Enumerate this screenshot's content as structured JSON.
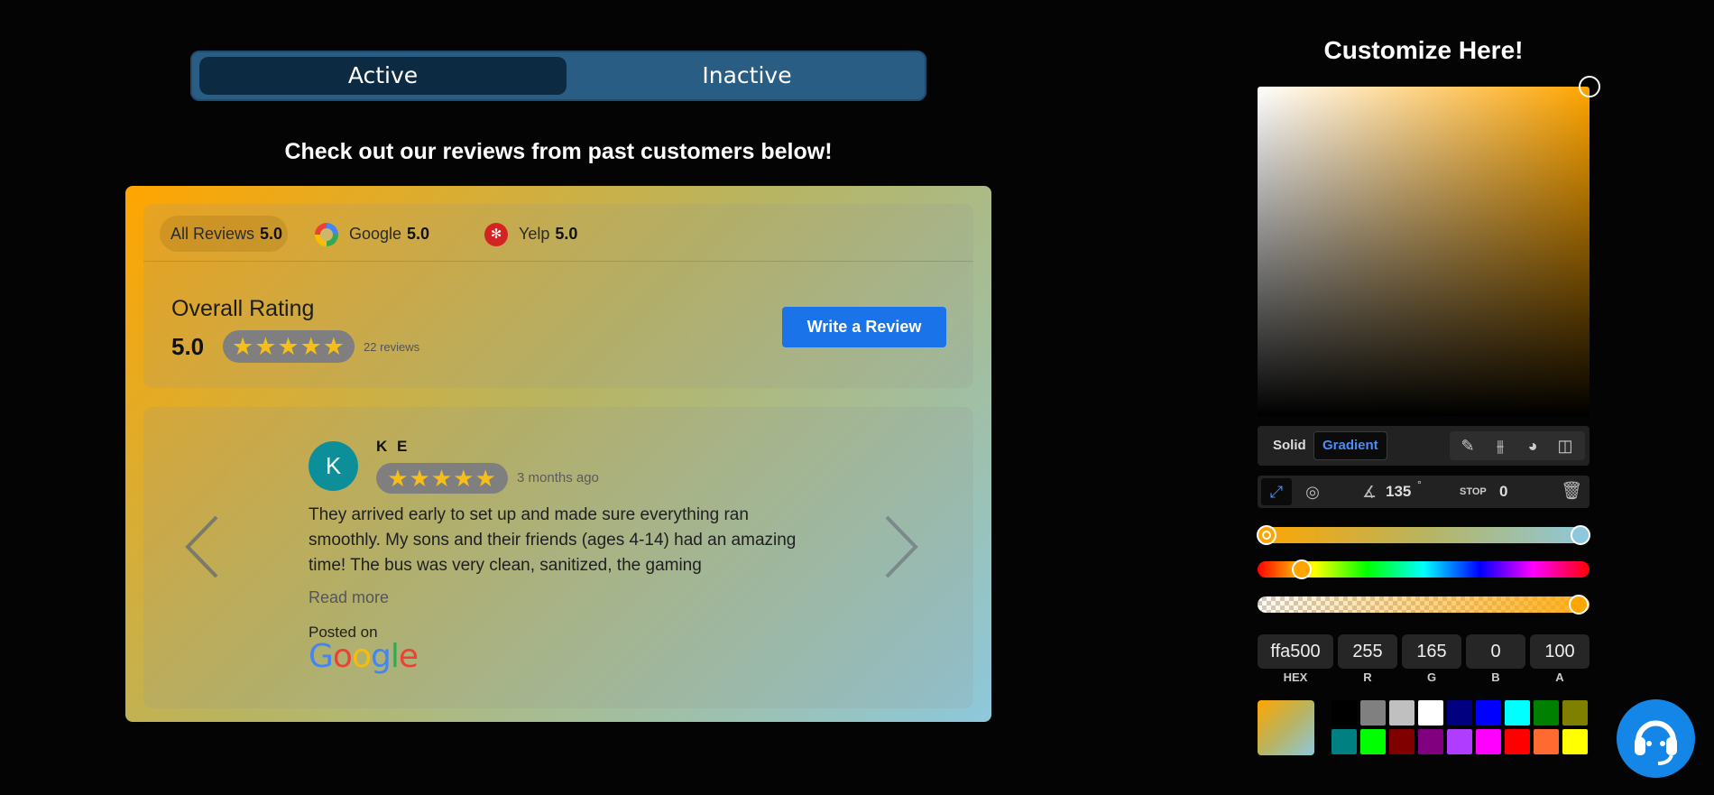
{
  "toggle": {
    "active_label": "Active",
    "inactive_label": "Inactive"
  },
  "headline": "Check out our reviews from past customers below!",
  "tabs": [
    {
      "label": "All Reviews",
      "score": "5.0"
    },
    {
      "label": "Google",
      "score": "5.0"
    },
    {
      "label": "Yelp",
      "score": "5.0"
    }
  ],
  "overall": {
    "label": "Overall Rating",
    "value": "5.0",
    "stars": "★★★★★",
    "rating_stars": 5,
    "count": "22 reviews",
    "write_button": "Write a Review"
  },
  "review": {
    "initial": "K",
    "name": "K E",
    "stars": "★★★★★",
    "rating_stars": 5,
    "time": "3 months ago",
    "text": "They arrived early to set up and made sure everything ran smoothly. My sons and their friends (ages 4-14) had an amazing time! The bus was very clean, sanitized, the gaming",
    "read_more": "Read more",
    "posted_on": "Posted on",
    "source_logo": "Google"
  },
  "customizer": {
    "title": "Customize Here!",
    "modes": {
      "solid": "Solid",
      "gradient": "Gradient"
    },
    "selected_mode": "Gradient",
    "angle": "135",
    "angle_unit": "°",
    "stop_label": "STOP",
    "stop_value": "0",
    "color_fields": [
      {
        "value": "ffa500",
        "label": "HEX"
      },
      {
        "value": "255",
        "label": "R"
      },
      {
        "value": "165",
        "label": "G"
      },
      {
        "value": "0",
        "label": "B"
      },
      {
        "value": "100",
        "label": "A"
      }
    ],
    "gradient_colors": [
      "#ffa500",
      "#8dc8dc"
    ],
    "hue_fraction": 0.11,
    "alpha_fraction": 1.0,
    "swatches": [
      "#000000",
      "#808080",
      "#c0c0c0",
      "#ffffff",
      "#000080",
      "#0000ff",
      "#00ffff",
      "#008000",
      "#808000",
      "#008080",
      "#00ff00",
      "#800000",
      "#800080",
      "#b03cff",
      "#ff00ff",
      "#ff0000",
      "#ff6a30",
      "#ffff00"
    ]
  },
  "colors": {
    "accent": "#1a73e8",
    "toggle_bg": "#2a5d84",
    "help_button": "#1486e8"
  }
}
